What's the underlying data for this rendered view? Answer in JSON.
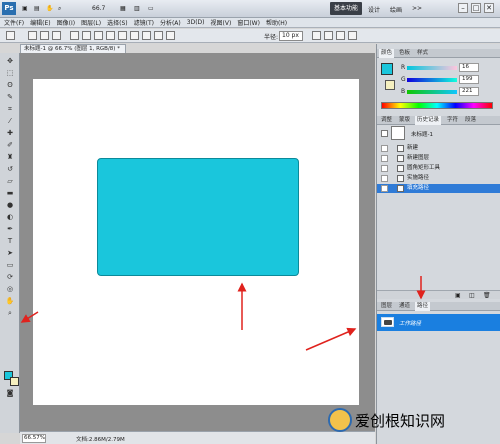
{
  "titlebar": {
    "logo": "Ps",
    "zoom": "66.7",
    "workspace_active": "基本功能",
    "workspace_items": [
      "设计",
      "绘画",
      ">>"
    ],
    "window_buttons": [
      "–",
      "□",
      "✕"
    ]
  },
  "menu": [
    "文件(F)",
    "编辑(E)",
    "图像(I)",
    "图层(L)",
    "选择(S)",
    "滤镜(T)",
    "分析(A)",
    "3D(D)",
    "视图(V)",
    "窗口(W)",
    "帮助(H)"
  ],
  "options": {
    "feather_label": "半径:",
    "feather_value": "10 px"
  },
  "document": {
    "tab_title": "未标题-1 @ 66.7% (图层 1, RGB/8) *",
    "tab_close": "×"
  },
  "statusbar": {
    "zoom": "66.57%",
    "doc_info": "文档:2.86M/2.79M"
  },
  "color_panel": {
    "tabs": [
      "颜色",
      "色板",
      "样式"
    ],
    "fg_color": "#1ac6dc",
    "bg_color": "#f5f0c0",
    "r_label": "R",
    "g_label": "G",
    "b_label": "B",
    "r_value": "16",
    "g_value": "199",
    "b_value": "221"
  },
  "history_panel": {
    "tabs": [
      "调整",
      "蒙版",
      "历史记录",
      "字符",
      "段落"
    ],
    "snapshot_label": "未标题-1",
    "items": [
      "新建",
      "新建图层",
      "圆角矩形工具",
      "实施路径",
      "填充路径"
    ]
  },
  "paths_panel": {
    "tabs": [
      "图层",
      "通道",
      "路径"
    ],
    "items": [
      "工作路径"
    ]
  },
  "shape": {
    "color": "#1ac6dc"
  },
  "watermark": {
    "text": "爱创根知识网"
  }
}
